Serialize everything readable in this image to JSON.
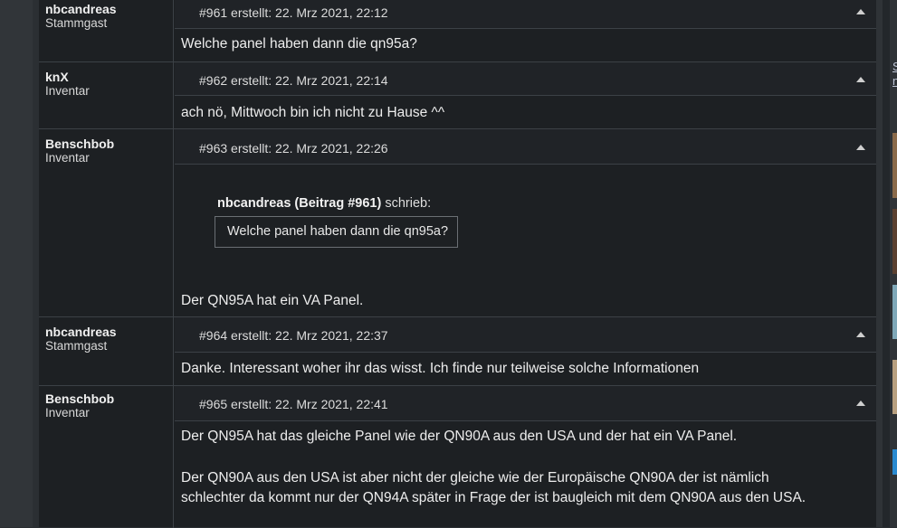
{
  "posts": [
    {
      "author": "nbcandreas",
      "rank": "Stammgast",
      "meta": "#961 erstellt: 22. Mrz 2021, 22:12",
      "lines": [
        "Welche panel haben dann die qn95a?"
      ]
    },
    {
      "author": "knX",
      "rank": "Inventar",
      "meta": "#962 erstellt: 22. Mrz 2021, 22:14",
      "lines": [
        "ach nö, Mittwoch bin ich nicht zu Hause ^^"
      ]
    },
    {
      "author": "Benschbob",
      "rank": "Inventar",
      "meta": "#963 erstellt: 22. Mrz 2021, 22:26",
      "quote": {
        "source": "nbcandreas (Beitrag #961)",
        "verb": "schrieb:",
        "text": "Welche panel haben dann die qn95a?"
      },
      "lines": [
        "Der QN95A hat ein VA Panel."
      ]
    },
    {
      "author": "nbcandreas",
      "rank": "Stammgast",
      "meta": "#964 erstellt: 22. Mrz 2021, 22:37",
      "lines": [
        "Danke. Interessant woher ihr das wisst. Ich finde nur teilweise solche Informationen"
      ]
    },
    {
      "author": "Benschbob",
      "rank": "Inventar",
      "meta": "#965 erstellt: 22. Mrz 2021, 22:41",
      "lines": [
        "Der QN95A hat das gleiche Panel wie der QN90A aus den USA und der hat ein VA Panel.",
        "Der QN90A aus den USA ist aber nicht der gleiche wie der Europäische QN90A der ist nämlich",
        "schlechter da kommt nur der QN94A später in Frage der ist baugleich mit dem QN90A aus den USA."
      ]
    }
  ],
  "sidebar": {
    "partial_link_1": "S",
    "partial_link_2": "n"
  }
}
